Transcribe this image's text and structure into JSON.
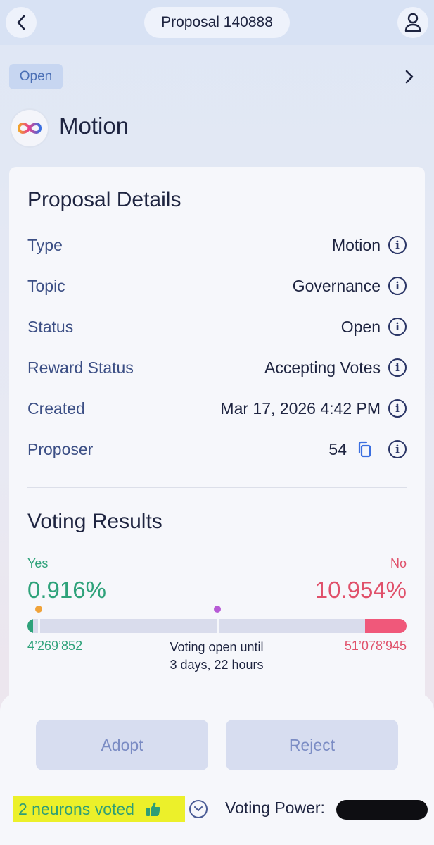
{
  "header": {
    "title": "Proposal 140888"
  },
  "proposal": {
    "status_badge": "Open",
    "name": "Motion"
  },
  "details": {
    "heading": "Proposal Details",
    "rows": [
      {
        "label": "Type",
        "value": "Motion"
      },
      {
        "label": "Topic",
        "value": "Governance"
      },
      {
        "label": "Status",
        "value": "Open"
      },
      {
        "label": "Reward Status",
        "value": "Accepting Votes"
      },
      {
        "label": "Created",
        "value": "Mar 17, 2026 4:42 PM"
      },
      {
        "label": "Proposer",
        "value": "54"
      }
    ]
  },
  "voting": {
    "heading": "Voting Results",
    "yes_label": "Yes",
    "no_label": "No",
    "yes_percent": "0.916%",
    "no_percent": "10.954%",
    "yes_votes": "4’269’852",
    "no_votes": "51’078’945",
    "deadline_line1": "Voting open until",
    "deadline_line2": "3 days, 22 hours",
    "yes_fraction": 0.00916,
    "no_fraction": 0.10954,
    "immediate_majority_marker": 0.03,
    "standard_majority_marker": 0.5
  },
  "actions": {
    "adopt_label": "Adopt",
    "reject_label": "Reject"
  },
  "footer": {
    "neurons_voted": "2 neurons voted",
    "voting_power_label": "Voting Power:"
  },
  "colors": {
    "yes": "#2ea27a",
    "no": "#e0506a",
    "accent": "#4b6fb5",
    "highlight": "#ecf02a"
  }
}
